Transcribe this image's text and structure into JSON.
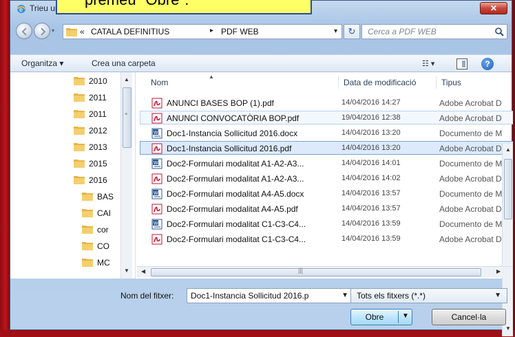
{
  "overlay": {
    "callout_text": "premeu \"Obre\"."
  },
  "window": {
    "title": "Trieu un fitxer per carregar",
    "close_label": "✕"
  },
  "address": {
    "crumbs": [
      "CATALA DEFINITIUS",
      "PDF WEB"
    ],
    "chevron": "«",
    "separator": "▸",
    "dropdown": "▾",
    "refresh": "↻",
    "search_placeholder": "Cerca a PDF WEB"
  },
  "toolbar": {
    "organize_label": "Organitza ▾",
    "new_folder_label": "Crea una carpeta",
    "views_label": "☷ ▾",
    "help_label": "?"
  },
  "navpane": {
    "items": [
      {
        "label": "2010"
      },
      {
        "label": "2011"
      },
      {
        "label": "2011"
      },
      {
        "label": "2012"
      },
      {
        "label": "2013"
      },
      {
        "label": "2015"
      },
      {
        "label": "2016"
      },
      {
        "label": "BAS"
      },
      {
        "label": "CAI"
      },
      {
        "label": "cor"
      },
      {
        "label": "CO"
      },
      {
        "label": "MC"
      }
    ]
  },
  "columns": {
    "name": "Nom",
    "date": "Data de modificació",
    "type": "Tipus"
  },
  "files": [
    {
      "name": "ANUNCI BASES BOP (1).pdf",
      "date": "14/04/2016 14:27",
      "type": "Adobe Acrobat D",
      "icon": "pdf"
    },
    {
      "name": "ANUNCI CONVOCATÒRIA BOP.pdf",
      "date": "19/04/2016 12:38",
      "type": "Adobe Acrobat D",
      "icon": "pdf"
    },
    {
      "name": "Doc1-Instancia Sollicitud 2016.docx",
      "date": "14/04/2016 13:20",
      "type": "Documento de M",
      "icon": "word"
    },
    {
      "name": "Doc1-Instancia Sollicitud 2016.pdf",
      "date": "14/04/2016 13:20",
      "type": "Adobe Acrobat D",
      "icon": "pdf"
    },
    {
      "name": "Doc2-Formulari modalitat A1-A2-A3...",
      "date": "14/04/2016 14:01",
      "type": "Documento de M",
      "icon": "word"
    },
    {
      "name": "Doc2-Formulari modalitat A1-A2-A3...",
      "date": "14/04/2016 14:02",
      "type": "Adobe Acrobat D",
      "icon": "pdf"
    },
    {
      "name": "Doc2-Formulari modalitat A4-A5.docx",
      "date": "14/04/2016 13:57",
      "type": "Documento de M",
      "icon": "word"
    },
    {
      "name": "Doc2-Formulari modalitat A4-A5.pdf",
      "date": "14/04/2016 13:57",
      "type": "Adobe Acrobat D",
      "icon": "pdf"
    },
    {
      "name": "Doc2-Formulari modalitat C1-C3-C4...",
      "date": "14/04/2016 13:59",
      "type": "Documento de M",
      "icon": "word"
    },
    {
      "name": "Doc2-Formulari modalitat C1-C3-C4...",
      "date": "14/04/2016 13:59",
      "type": "Adobe Acrobat D",
      "icon": "pdf"
    }
  ],
  "selection": {
    "selected_file": "Doc1-Instancia Sollicitud 2016.pdf",
    "hover_file": "ANUNCI CONVOCATÒRIA BOP.pdf"
  },
  "bottom": {
    "filename_label": "Nom del fitxer:",
    "filename_value": "Doc1-Instancia Sollicitud 2016.p",
    "filter_value": "Tots els fitxers (*.*)",
    "open_label": "Obre",
    "cancel_label": "Cancel·la"
  },
  "colors": {
    "pdf": "#c8102e",
    "word": "#2b5797",
    "folder": "#e8b44a",
    "accent": "#3c7fb1"
  }
}
